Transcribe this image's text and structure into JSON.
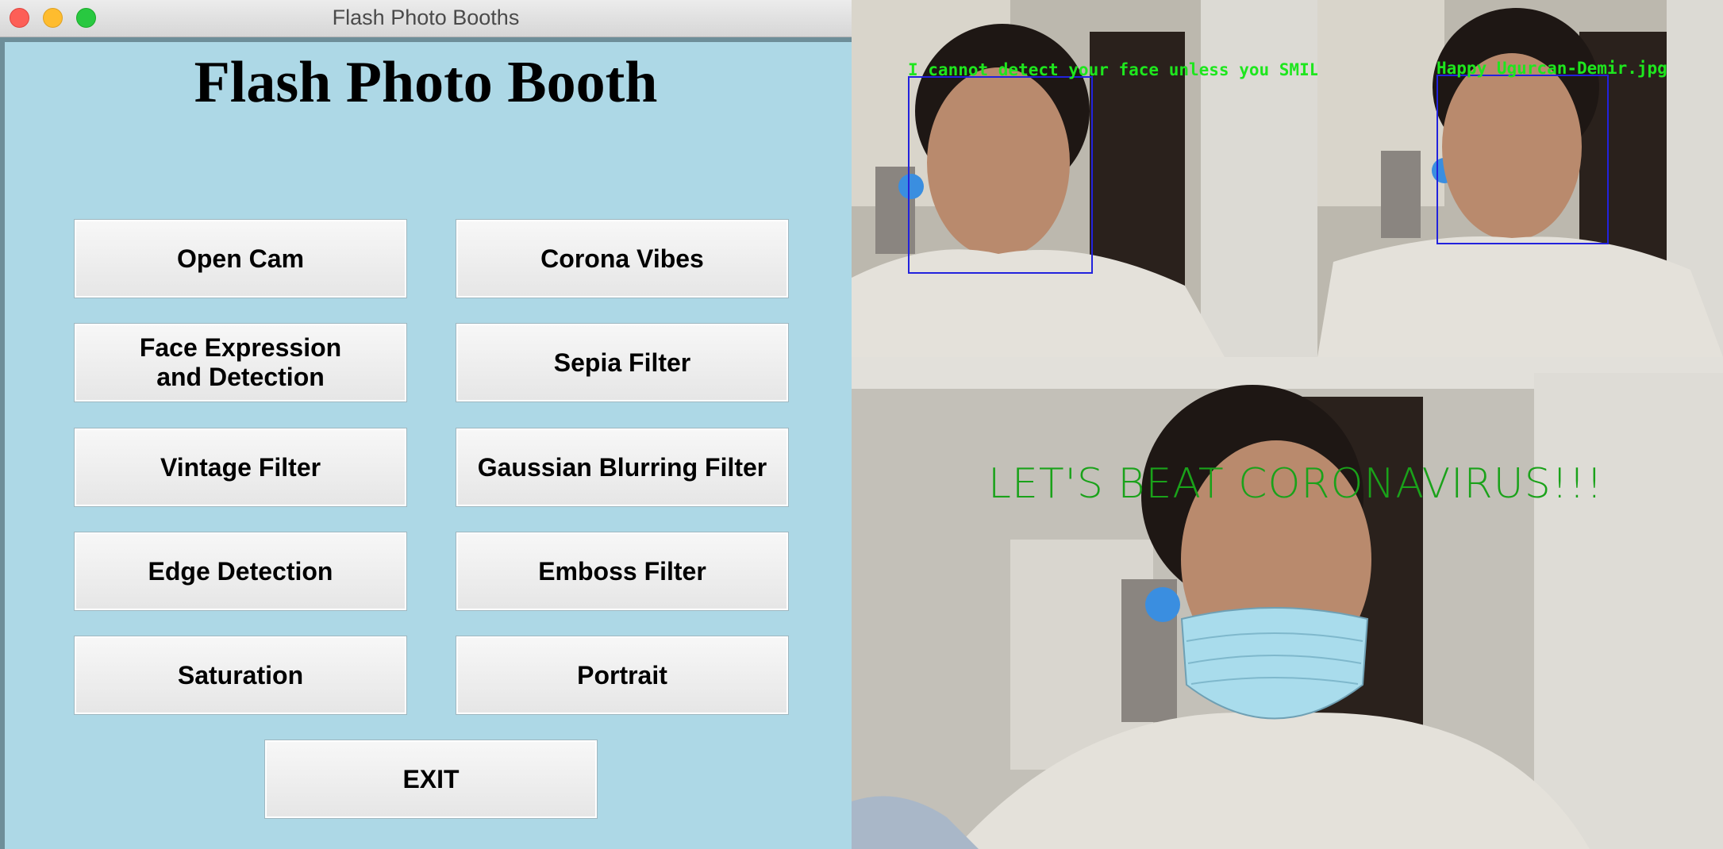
{
  "window": {
    "title": "Flash Photo Booths",
    "heading": "Flash Photo Booth"
  },
  "buttons": {
    "open_cam": "Open Cam",
    "corona_vibes": "Corona Vibes",
    "face_expression": "Face Expression\nand Detection",
    "sepia_filter": "Sepia Filter",
    "vintage_filter": "Vintage Filter",
    "gaussian_blurring": "Gaussian Blurring Filter",
    "edge_detection": "Edge Detection",
    "emboss_filter": "Emboss Filter",
    "saturation": "Saturation",
    "portrait": "Portrait",
    "exit": "EXIT"
  },
  "camera": {
    "frame1_text": "I cannot detect your face unless you SMILE !!!",
    "frame2_text": "Happy Ugurcan-Demir.jpg",
    "frame3_text": "LET'S BEAT CORONAVIRUS!!!"
  },
  "colors": {
    "app_background": "#add8e6",
    "overlay_text_green": "#1ee61e",
    "face_box_blue": "#2222dd",
    "mask_text_green": "#1aa21a"
  }
}
